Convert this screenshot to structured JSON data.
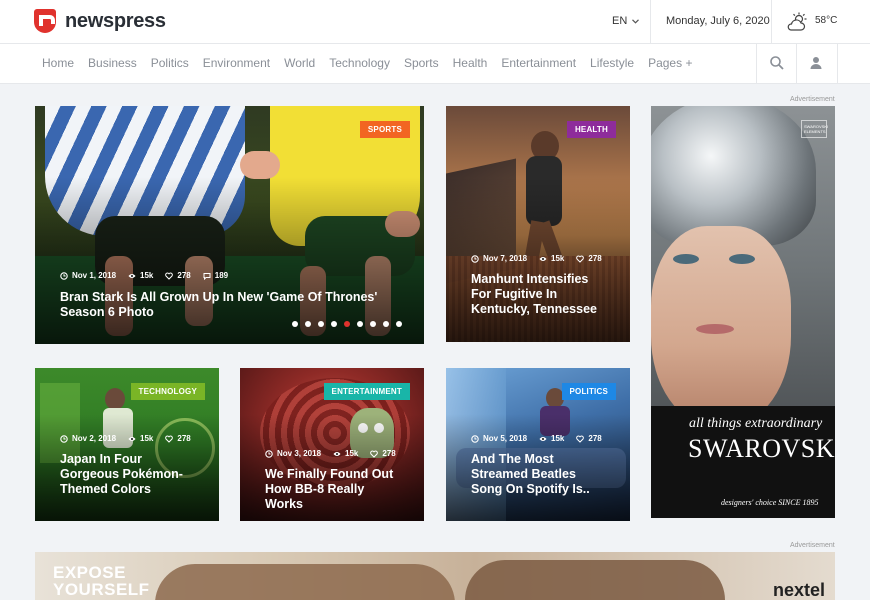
{
  "header": {
    "logo_text": "newspress",
    "language": "EN",
    "date": "Monday, July 6, 2020",
    "temperature": "58°C",
    "weather_icon": "cloud-sun-icon"
  },
  "nav": {
    "items": [
      "Home",
      "Business",
      "Politics",
      "Environment",
      "World",
      "Technology",
      "Sports",
      "Health",
      "Entertainment",
      "Lifestyle",
      "Pages +"
    ],
    "search_icon": "search-icon",
    "user_icon": "user-icon"
  },
  "featured": {
    "badge": "SPORTS",
    "badge_color": "#f26522",
    "date": "Nov 1, 2018",
    "views": "15k",
    "likes": "278",
    "comments": "189",
    "title": "Bran Stark Is All Grown Up In New 'Game Of Thrones' Season 6 Photo",
    "slider_count": 9,
    "active_slide": 5
  },
  "cards": [
    {
      "id": "health",
      "badge": "HEALTH",
      "badge_color": "#8e2c9b",
      "date": "Nov 7, 2018",
      "views": "15k",
      "likes": "278",
      "title": "Manhunt Intensifies For Fugitive In Kentucky, Tennessee"
    },
    {
      "id": "technology",
      "badge": "TECHNOLOGY",
      "badge_color": "#7ab526",
      "date": "Nov 2, 2018",
      "views": "15k",
      "likes": "278",
      "title": "Japan In Four Gorgeous Pokémon-Themed Colors"
    },
    {
      "id": "entertainment",
      "badge": "ENTERTAINMENT",
      "badge_color": "#19b5a8",
      "date": "Nov 3, 2018",
      "views": "15k",
      "likes": "278",
      "title": "We Finally Found Out How BB-8 Really Works"
    },
    {
      "id": "politics",
      "badge": "POLITICS",
      "badge_color": "#1e88e5",
      "date": "Nov 5, 2018",
      "views": "15k",
      "likes": "278",
      "title": "And The Most Streamed Beatles Song On Spotify Is.."
    }
  ],
  "ads": {
    "label": "Advertisement",
    "side_tagline": "all things extraordinary",
    "side_brand": "SWAROVSKI",
    "side_footer": "designers' choice SINCE 1895",
    "side_badge": "SWAROVSKI ELEMENTS",
    "banner_text_1": "EXPOSE",
    "banner_text_2": "YOURSELF",
    "banner_brand": "nextel"
  }
}
